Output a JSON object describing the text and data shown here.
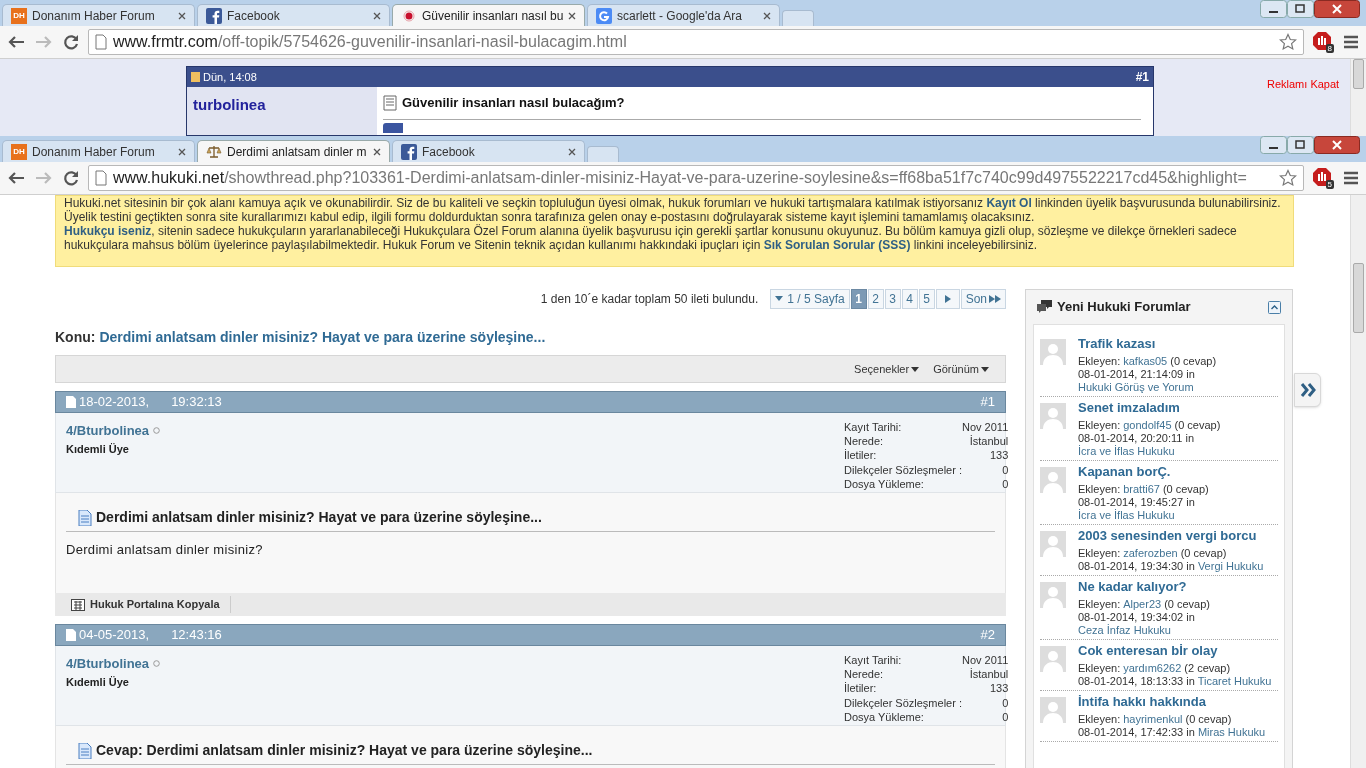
{
  "background_window": {
    "tabs": [
      {
        "label": "Donanım Haber Forum",
        "kind": "dh",
        "icon_text": "DH",
        "selected": false
      },
      {
        "label": "Facebook",
        "kind": "facebook",
        "selected": false
      },
      {
        "label": "Güvenilir insanları nasıl bu",
        "kind": "dot",
        "selected": true
      },
      {
        "label": "scarlett - Google'da Ara",
        "kind": "google",
        "selected": false
      }
    ],
    "address": {
      "host": "www.frmtr.com",
      "path": "/off-topik/5754626-guvenilir-insanlari-nasil-bulacagim.html"
    },
    "extension_badge": "8",
    "post": {
      "date": "Dün, 14:08",
      "number": "#1",
      "author": "turbolinea",
      "title": "Güvenilir insanları nasıl bulacağım?"
    },
    "ad_close": "Reklamı Kapat"
  },
  "window": {
    "tabs": [
      {
        "label": "Donanım Haber Forum",
        "kind": "dh",
        "icon_text": "DH",
        "selected": false
      },
      {
        "label": "Derdimi anlatsam dinler m",
        "kind": "scales",
        "selected": true
      },
      {
        "label": "Facebook",
        "kind": "facebook",
        "selected": false
      }
    ],
    "address": {
      "host": "www.hukuki.net",
      "path": "/showthread.php?103361-Derdimi-anlatsam-dinler-misiniz-Hayat-ve-para-uzerine-soylesine&s=ff68ba51f7c740c99d4975522217cd45&highlight="
    },
    "extension_badge": "5",
    "notice": [
      "Hukuki.net sitesinin bir çok alanı kamuya açık ve okunabilirdir. Siz de bu kaliteli ve seçkin topluluğun üyesi olmak, hukuk forumları ve hukuki tartışmalara katılmak istiyorsanız **Kayıt Ol** linkinden üyelik başvurusunda bulunabilirsiniz. Üyelik testini geçtikten sonra site kurallarımızı kabul edip, ilgili formu doldurduktan sonra tarafınıza gelen onay e-postasını doğrulayarak sisteme kayıt işlemini tamamlamış olacaksınız.",
      "**Hukukçu iseniz**, sitenin sadece hukukçuların yararlanabileceği Hukukçulara Özel Forum alanına üyelik başvurusu için gerekli şartlar konusunu okuyunuz. Bu bölüm kamuya gizli olup, sözleşme ve dilekçe örnekleri sadece hukukçulara mahsus bölüm üyelerince paylaşılabilmektedir. Hukuk Forum ve Sitenin teknik açıdan kullanımı hakkındaki ipuçları için **Sık Sorulan Sorular (SSS)** linkini inceleyebilirsiniz."
    ],
    "pagination": {
      "summary": "1 den 10´e kadar toplam 50 ileti bulundu.",
      "page_select": "1 / 5 Sayfa",
      "pages": [
        {
          "label": "1",
          "selected": true
        },
        {
          "label": "2",
          "selected": false
        },
        {
          "label": "3",
          "selected": false
        },
        {
          "label": "4",
          "selected": false
        },
        {
          "label": "5",
          "selected": false
        }
      ],
      "last": "Son"
    },
    "thread": {
      "prefix": "Konu:",
      "title": "Derdimi anlatsam dinler misiniz? Hayat ve para üzerine söyleşine..."
    },
    "toolbar": [
      "Seçenekler",
      "Görünüm"
    ],
    "posts": [
      {
        "date": "18-02-2013,",
        "time": "19:32:13",
        "number": "#1",
        "author": "4/Bturbolinea",
        "rank": "Kıdemli Üye",
        "stats": [
          {
            "label": "Kayıt Tarihi:",
            "value": "Nov 2011"
          },
          {
            "label": "Nerede:",
            "value": "İstanbul"
          },
          {
            "label": "İletiler:",
            "value": "133"
          },
          {
            "label": "Dilekçeler Sözleşmeler :",
            "value": "0"
          },
          {
            "label": "Dosya Yükleme:",
            "value": "0"
          }
        ],
        "title": "Derdimi anlatsam dinler misiniz? Hayat ve para üzerine söyleşine...",
        "body": "Derdimi anlatsam dinler misiniz?",
        "footer_button": "Hukuk Portalına Kopyala"
      },
      {
        "date": "04-05-2013,",
        "time": "12:43:16",
        "number": "#2",
        "author": "4/Bturbolinea",
        "rank": "Kıdemli Üye",
        "stats": [
          {
            "label": "Kayıt Tarihi:",
            "value": "Nov 2011"
          },
          {
            "label": "Nerede:",
            "value": "İstanbul"
          },
          {
            "label": "İletiler:",
            "value": "133"
          },
          {
            "label": "Dilekçeler Sözleşmeler :",
            "value": "0"
          },
          {
            "label": "Dosya Yükleme:",
            "value": "0"
          }
        ],
        "title": "Cevap: Derdimi anlatsam dinler misiniz? Hayat ve para üzerine söyleşine..."
      }
    ],
    "sidebar": {
      "title": "Yeni Hukuki Forumlar",
      "items": [
        {
          "title": "Trafik kazası",
          "by": "Ekleyen:",
          "author": "kafkas05",
          "replies": "(0 cevap)",
          "posted": "08-01-2014, 21:14:09 in",
          "forum": "Hukuki Görüş ve Yorum"
        },
        {
          "title": "Senet imzaladım",
          "by": "Ekleyen:",
          "author": "gondolf45",
          "replies": "(0 cevap)",
          "posted": "08-01-2014, 20:20:11 in",
          "forum": "İcra ve İflas Hukuku"
        },
        {
          "title": "Kapanan borÇ.",
          "by": "Ekleyen:",
          "author": "bratti67",
          "replies": "(0 cevap)",
          "posted": "08-01-2014, 19:45:27 in",
          "forum": "İcra ve İflas Hukuku"
        },
        {
          "title": "2003 senesinden vergi borcu",
          "by": "Ekleyen:",
          "author": "zaferozben",
          "replies": "(0 cevap)",
          "posted": "08-01-2014, 19:34:30 in",
          "forum": "Vergi Hukuku"
        },
        {
          "title": "Ne kadar kalıyor?",
          "by": "Ekleyen:",
          "author": "Alper23",
          "replies": "(0 cevap)",
          "posted": "08-01-2014, 19:34:02 in",
          "forum": "Ceza İnfaz Hukuku"
        },
        {
          "title": "Cok enteresan bİr olay",
          "by": "Ekleyen:",
          "author": "yardım6262",
          "replies": "(2 cevap)",
          "posted": "08-01-2014, 18:13:33 in",
          "forum": "Ticaret Hukuku"
        },
        {
          "title": "İntifa hakkı hakkında",
          "by": "Ekleyen:",
          "author": "hayrimenkul",
          "replies": "(0 cevap)",
          "posted": "08-01-2014, 17:42:33 in",
          "forum": "Miras Hukuku"
        }
      ]
    }
  }
}
